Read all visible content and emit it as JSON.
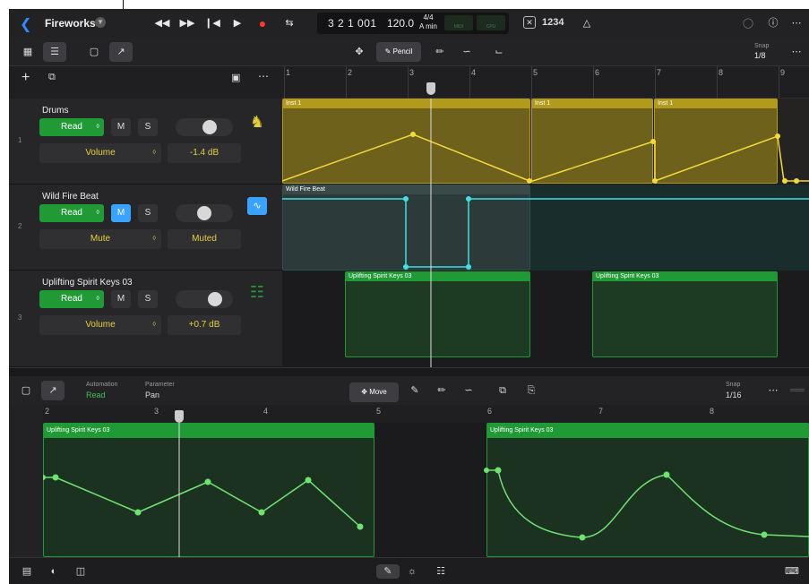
{
  "header": {
    "project_title": "Fireworks",
    "lcd_position": "3 2 1 001",
    "lcd_tempo": "120.0",
    "lcd_signature": "4/4",
    "lcd_key": "A min",
    "lcd_midi_label": "MIDI",
    "lcd_cpu_label": "CPU",
    "count_in": "1234"
  },
  "toolbar": {
    "pencil_label": "Pencil",
    "snap_label": "Snap",
    "snap_value": "1/8"
  },
  "ruler_bars": [
    "1",
    "2",
    "3",
    "4",
    "5",
    "6",
    "7",
    "8",
    "9"
  ],
  "tracks": [
    {
      "number": "1",
      "name": "Drums",
      "mode": "Read",
      "mute": "M",
      "solo": "S",
      "parameter": "Volume",
      "value": "-1.4 dB",
      "mute_on": false
    },
    {
      "number": "2",
      "name": "Wild Fire Beat",
      "mode": "Read",
      "mute": "M",
      "solo": "S",
      "parameter": "Mute",
      "value": "Muted",
      "mute_on": true
    },
    {
      "number": "3",
      "name": "Uplifting Spirit Keys 03",
      "mode": "Read",
      "mute": "M",
      "solo": "S",
      "parameter": "Volume",
      "value": "+0.7 dB",
      "mute_on": false
    }
  ],
  "regions": {
    "drums_a": "Inst 1",
    "drums_b": "Inst 1",
    "drums_c": "Inst 1",
    "beat": "Wild Fire Beat",
    "keys_a": "Uplifting Spirit Keys 03",
    "keys_b": "Uplifting Spirit Keys 03"
  },
  "editor": {
    "automation_label": "Automation",
    "automation_value": "Read",
    "parameter_label": "Parameter",
    "parameter_value": "Pan",
    "move_label": "Move",
    "snap_label": "Snap",
    "snap_value": "1/16",
    "ruler_bars": [
      "2",
      "3",
      "4",
      "5",
      "6",
      "7",
      "8"
    ],
    "region_a": "Uplifting Spirit Keys 03",
    "region_b": "Uplifting Spirit Keys 03"
  },
  "colors": {
    "drums_region": "#b39a1c",
    "beat_region": "#1e6b6b",
    "keys_region": "#1f9a35",
    "automation_yellow": "#f2da3a",
    "automation_cyan": "#3fe0e6",
    "automation_green": "#6fe36f",
    "read_button": "#1f9a35",
    "mute_on": "#3aa3ff"
  }
}
